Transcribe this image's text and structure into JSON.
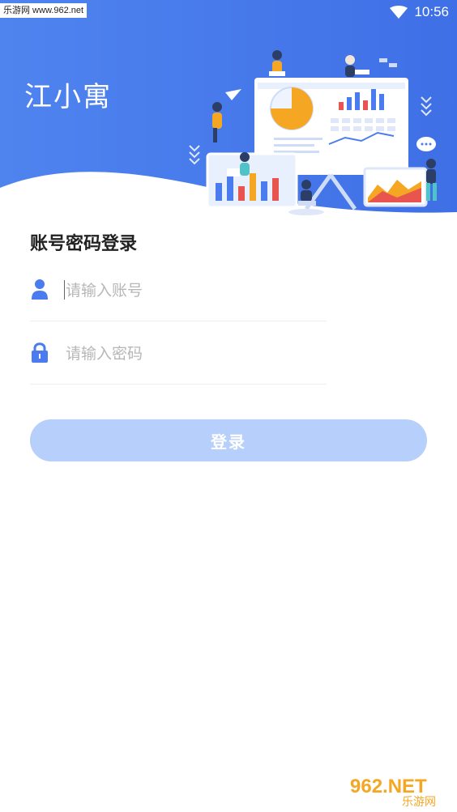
{
  "watermark_top": "乐游网 www.962.net",
  "status_bar": {
    "time": "10:56",
    "wifi_icon": "wifi-icon"
  },
  "header": {
    "app_title": "江小寓"
  },
  "form": {
    "title": "账号密码登录",
    "username": {
      "placeholder": "请输入账号",
      "value": "",
      "icon": "user-icon"
    },
    "password": {
      "placeholder": "请输入密码",
      "value": "",
      "icon": "lock-icon"
    },
    "login_button": "登录"
  },
  "watermark_bottom": {
    "brand": "962.NET",
    "sub": "乐游网"
  },
  "colors": {
    "header_blue": "#3f73e9",
    "icon_blue": "#4a7cf0",
    "button_disabled": "#b7cffb",
    "accent_orange": "#f5a623"
  }
}
